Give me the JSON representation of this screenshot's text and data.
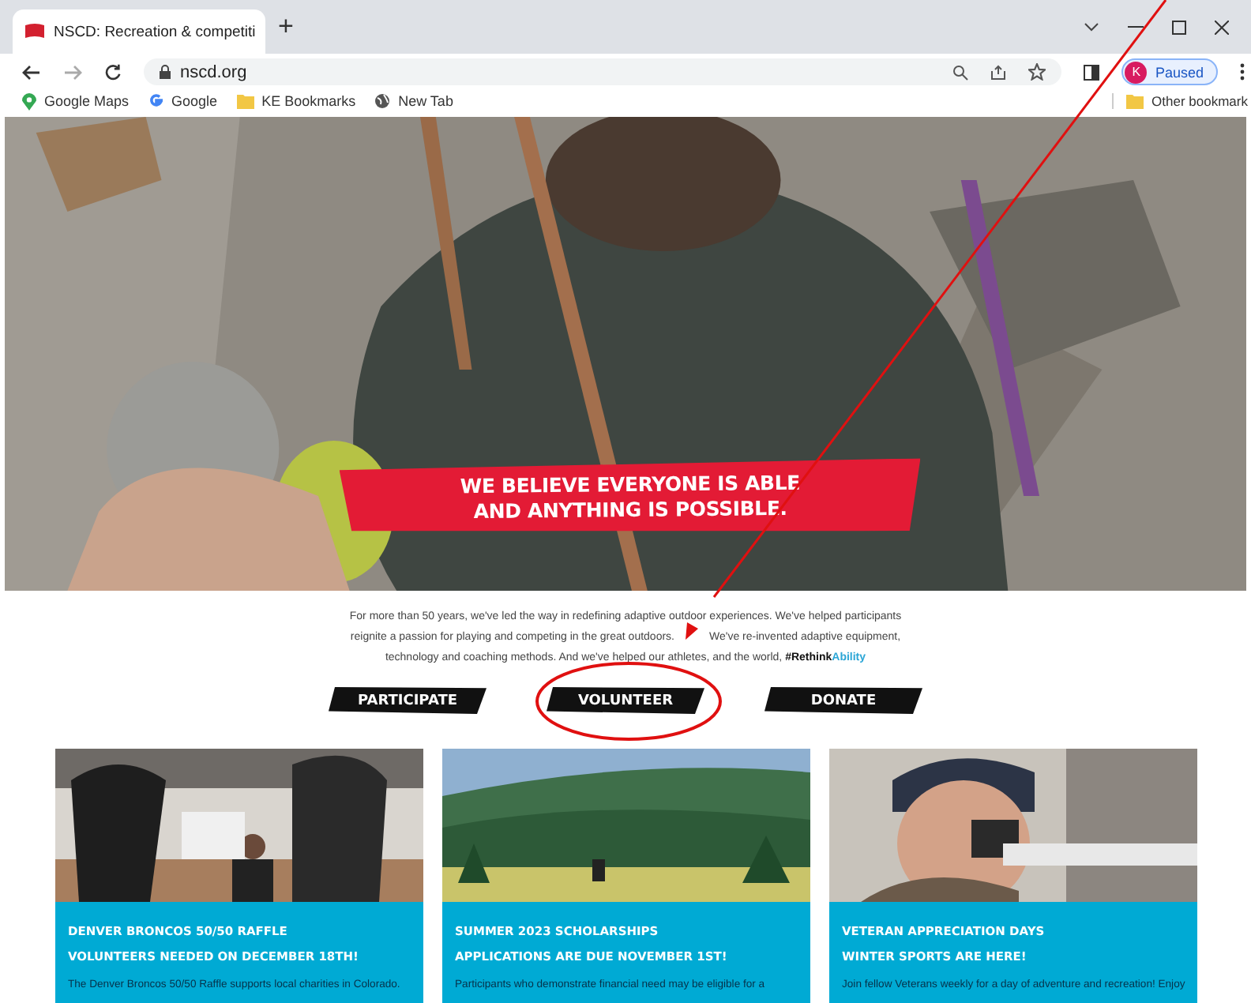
{
  "browser": {
    "tab": {
      "title": "NSCD: Recreation & competiti",
      "selected": true
    },
    "new_tab": "+",
    "url": "nscd.org",
    "profile": {
      "initial": "K",
      "status": "Paused"
    },
    "bookmarks": [
      {
        "label": "Google Maps",
        "kind": "maps"
      },
      {
        "label": "Google",
        "kind": "google"
      },
      {
        "label": "KE Bookmarks",
        "kind": "folder"
      },
      {
        "label": "New Tab",
        "kind": "globe"
      }
    ],
    "other_bookmarks": "Other bookmark"
  },
  "hero": {
    "kind": "picture",
    "headline": [
      "WE BELIEVE EVERYONE IS ABLE",
      "AND ANYTHING IS POSSIBLE."
    ]
  },
  "intro": {
    "text": "For more than 50 years, we've led the way in redefining adaptive outdoor experiences. We've helped participants reignite a passion for playing and competing in the great outdoors.",
    "text_after": "We've re-invented adaptive equipment, technology and coaching methods. And we've helped our athletes, and the world, ",
    "hashtag_bold": "#Rethink",
    "hashtag_link": "Ability"
  },
  "actions": [
    {
      "label": "PARTICIPATE",
      "circled": false
    },
    {
      "label": "VOLUNTEER",
      "circled": true
    },
    {
      "label": "DONATE",
      "circled": false
    }
  ],
  "cards": [
    {
      "kind": "football",
      "title": "DENVER BRONCOS 50/50 RAFFLE",
      "subtitle": "VOLUNTEERS NEEDED ON DECEMBER 18TH!",
      "text": "The Denver Broncos 50/50 Raffle supports local charities in Colorado."
    },
    {
      "kind": "forest",
      "title": "SUMMER 2023 SCHOLARSHIPS",
      "subtitle": "APPLICATIONS ARE DUE NOVEMBER 1ST!",
      "text": "Participants who demonstrate financial need may be eligible for a"
    },
    {
      "kind": "shooter",
      "title": "VETERAN APPRECIATION DAYS",
      "subtitle": "WINTER SPORTS ARE HERE!",
      "text": "Join fellow Veterans weekly for a day of adventure and recreation! Enjoy"
    }
  ]
}
